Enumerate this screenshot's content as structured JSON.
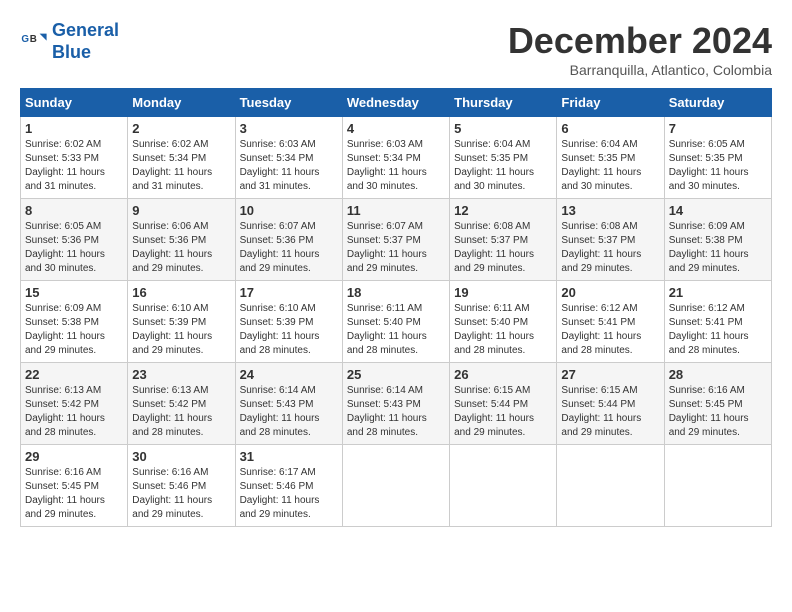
{
  "logo": {
    "line1": "General",
    "line2": "Blue"
  },
  "title": "December 2024",
  "subtitle": "Barranquilla, Atlantico, Colombia",
  "headers": [
    "Sunday",
    "Monday",
    "Tuesday",
    "Wednesday",
    "Thursday",
    "Friday",
    "Saturday"
  ],
  "weeks": [
    [
      {
        "day": "1",
        "sunrise": "6:02 AM",
        "sunset": "5:33 PM",
        "daylight": "11 hours and 31 minutes."
      },
      {
        "day": "2",
        "sunrise": "6:02 AM",
        "sunset": "5:34 PM",
        "daylight": "11 hours and 31 minutes."
      },
      {
        "day": "3",
        "sunrise": "6:03 AM",
        "sunset": "5:34 PM",
        "daylight": "11 hours and 31 minutes."
      },
      {
        "day": "4",
        "sunrise": "6:03 AM",
        "sunset": "5:34 PM",
        "daylight": "11 hours and 30 minutes."
      },
      {
        "day": "5",
        "sunrise": "6:04 AM",
        "sunset": "5:35 PM",
        "daylight": "11 hours and 30 minutes."
      },
      {
        "day": "6",
        "sunrise": "6:04 AM",
        "sunset": "5:35 PM",
        "daylight": "11 hours and 30 minutes."
      },
      {
        "day": "7",
        "sunrise": "6:05 AM",
        "sunset": "5:35 PM",
        "daylight": "11 hours and 30 minutes."
      }
    ],
    [
      {
        "day": "8",
        "sunrise": "6:05 AM",
        "sunset": "5:36 PM",
        "daylight": "11 hours and 30 minutes."
      },
      {
        "day": "9",
        "sunrise": "6:06 AM",
        "sunset": "5:36 PM",
        "daylight": "11 hours and 29 minutes."
      },
      {
        "day": "10",
        "sunrise": "6:07 AM",
        "sunset": "5:36 PM",
        "daylight": "11 hours and 29 minutes."
      },
      {
        "day": "11",
        "sunrise": "6:07 AM",
        "sunset": "5:37 PM",
        "daylight": "11 hours and 29 minutes."
      },
      {
        "day": "12",
        "sunrise": "6:08 AM",
        "sunset": "5:37 PM",
        "daylight": "11 hours and 29 minutes."
      },
      {
        "day": "13",
        "sunrise": "6:08 AM",
        "sunset": "5:37 PM",
        "daylight": "11 hours and 29 minutes."
      },
      {
        "day": "14",
        "sunrise": "6:09 AM",
        "sunset": "5:38 PM",
        "daylight": "11 hours and 29 minutes."
      }
    ],
    [
      {
        "day": "15",
        "sunrise": "6:09 AM",
        "sunset": "5:38 PM",
        "daylight": "11 hours and 29 minutes."
      },
      {
        "day": "16",
        "sunrise": "6:10 AM",
        "sunset": "5:39 PM",
        "daylight": "11 hours and 29 minutes."
      },
      {
        "day": "17",
        "sunrise": "6:10 AM",
        "sunset": "5:39 PM",
        "daylight": "11 hours and 28 minutes."
      },
      {
        "day": "18",
        "sunrise": "6:11 AM",
        "sunset": "5:40 PM",
        "daylight": "11 hours and 28 minutes."
      },
      {
        "day": "19",
        "sunrise": "6:11 AM",
        "sunset": "5:40 PM",
        "daylight": "11 hours and 28 minutes."
      },
      {
        "day": "20",
        "sunrise": "6:12 AM",
        "sunset": "5:41 PM",
        "daylight": "11 hours and 28 minutes."
      },
      {
        "day": "21",
        "sunrise": "6:12 AM",
        "sunset": "5:41 PM",
        "daylight": "11 hours and 28 minutes."
      }
    ],
    [
      {
        "day": "22",
        "sunrise": "6:13 AM",
        "sunset": "5:42 PM",
        "daylight": "11 hours and 28 minutes."
      },
      {
        "day": "23",
        "sunrise": "6:13 AM",
        "sunset": "5:42 PM",
        "daylight": "11 hours and 28 minutes."
      },
      {
        "day": "24",
        "sunrise": "6:14 AM",
        "sunset": "5:43 PM",
        "daylight": "11 hours and 28 minutes."
      },
      {
        "day": "25",
        "sunrise": "6:14 AM",
        "sunset": "5:43 PM",
        "daylight": "11 hours and 28 minutes."
      },
      {
        "day": "26",
        "sunrise": "6:15 AM",
        "sunset": "5:44 PM",
        "daylight": "11 hours and 29 minutes."
      },
      {
        "day": "27",
        "sunrise": "6:15 AM",
        "sunset": "5:44 PM",
        "daylight": "11 hours and 29 minutes."
      },
      {
        "day": "28",
        "sunrise": "6:16 AM",
        "sunset": "5:45 PM",
        "daylight": "11 hours and 29 minutes."
      }
    ],
    [
      {
        "day": "29",
        "sunrise": "6:16 AM",
        "sunset": "5:45 PM",
        "daylight": "11 hours and 29 minutes."
      },
      {
        "day": "30",
        "sunrise": "6:16 AM",
        "sunset": "5:46 PM",
        "daylight": "11 hours and 29 minutes."
      },
      {
        "day": "31",
        "sunrise": "6:17 AM",
        "sunset": "5:46 PM",
        "daylight": "11 hours and 29 minutes."
      },
      null,
      null,
      null,
      null
    ]
  ]
}
